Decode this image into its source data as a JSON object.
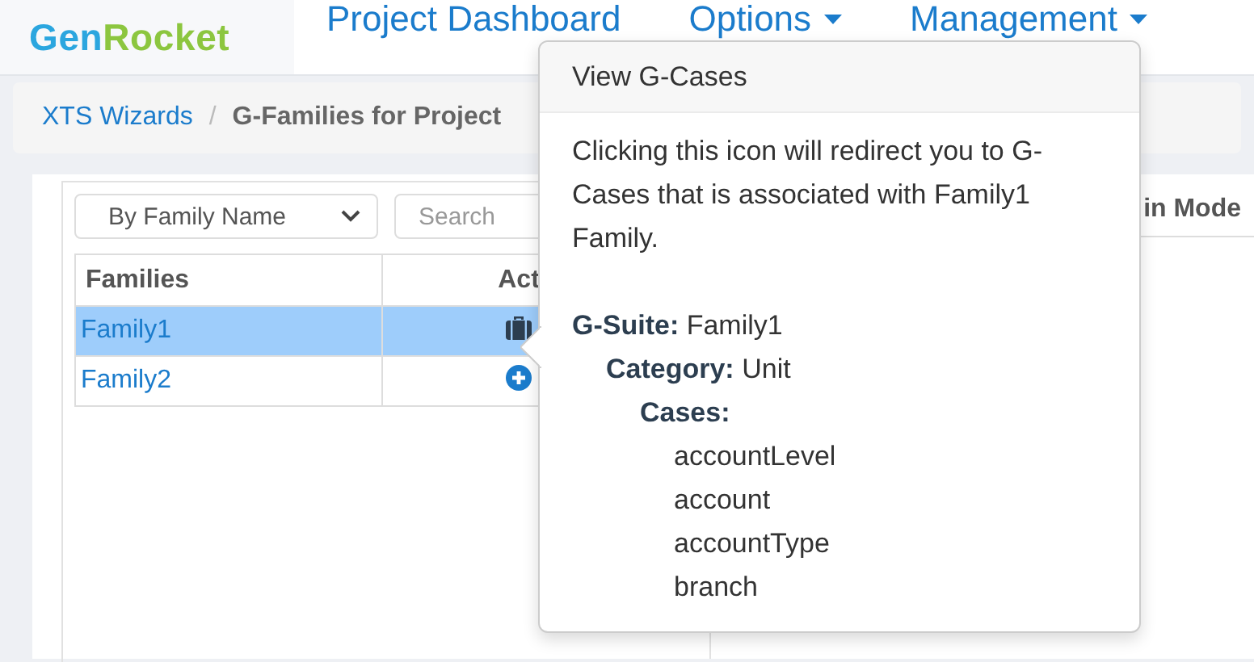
{
  "nav": {
    "logo": {
      "part_1": "Gen",
      "part_2": "Rocket"
    },
    "items": [
      {
        "label": "Project Dashboard",
        "dropdown": false
      },
      {
        "label": "Options",
        "dropdown": true
      },
      {
        "label": "Management",
        "dropdown": true
      }
    ]
  },
  "breadcrumb_separator": "/",
  "breadcrumb": [
    {
      "label": "XTS Wizards",
      "kind": "link"
    },
    {
      "label": "G-Families for Project",
      "kind": "current"
    }
  ],
  "filter": {
    "mode": "By Family Name",
    "search_placeholder": "Search"
  },
  "table": {
    "columns": [
      "Families",
      "Act"
    ],
    "rows": [
      {
        "name": "Family1",
        "selected": true,
        "kind": "cases"
      },
      {
        "name": "Family2",
        "selected": false,
        "kind": "add"
      }
    ]
  },
  "right_panel": {
    "heading": "in Mode"
  },
  "popover": {
    "title": "View G-Cases",
    "message": "Clicking this icon will redirect you to G-Cases that is associated with Family1 Family.",
    "suite": {
      "label": "G-Suite:",
      "value": "Family1"
    },
    "category": {
      "label": "Category:",
      "value": "Unit"
    },
    "cases_label": "Cases:",
    "cases": [
      "accountLevel",
      "account",
      "accountType",
      "branch"
    ]
  }
}
